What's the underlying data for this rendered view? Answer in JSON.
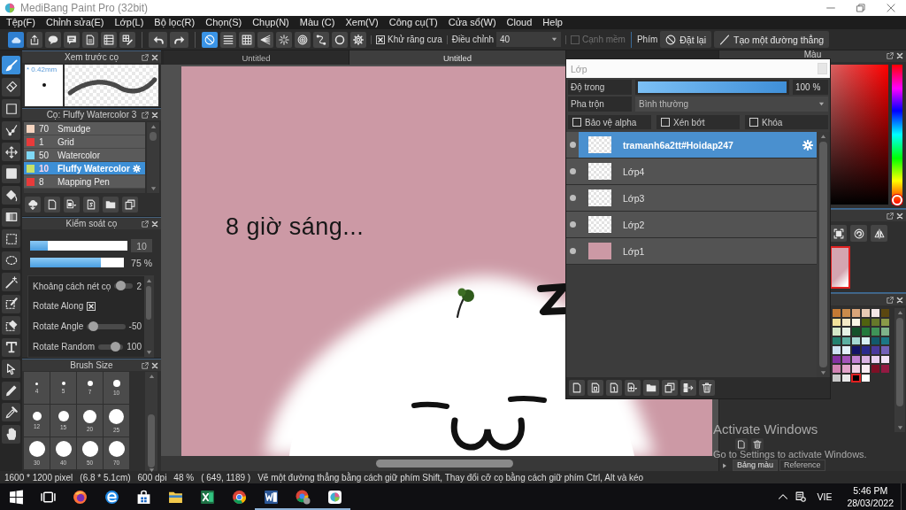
{
  "window": {
    "title": "MediBang Paint Pro (32bit)"
  },
  "menu": [
    "Tệp(F)",
    "Chỉnh sửa(E)",
    "Lớp(L)",
    "Bộ lọc(R)",
    "Chọn(S)",
    "Chụp(N)",
    "Màu (C)",
    "Xem(V)",
    "Công cụ(T)",
    "Cửa sổ(W)",
    "Cloud",
    "Help"
  ],
  "toolbar": {
    "file_tools": [
      {
        "kind": "cloud"
      },
      {
        "kind": "share"
      },
      {
        "kind": "bubble"
      },
      {
        "kind": "comment"
      },
      {
        "kind": "page"
      },
      {
        "kind": "list"
      },
      {
        "kind": "grid-edit"
      }
    ],
    "history": [
      {
        "kind": "undo"
      },
      {
        "kind": "redo"
      }
    ],
    "snaps": [
      {
        "kind": "off",
        "selected": true
      },
      {
        "kind": "parallel",
        "selected": false
      },
      {
        "kind": "grid",
        "selected": false
      },
      {
        "kind": "perspective",
        "selected": false
      },
      {
        "kind": "radial",
        "selected": false
      },
      {
        "kind": "concentric",
        "selected": false
      },
      {
        "kind": "curve",
        "selected": false
      },
      {
        "kind": "circle",
        "selected": false
      },
      {
        "kind": "settings",
        "selected": false
      }
    ],
    "antialias": {
      "label": "Khử răng cưa",
      "checked": true
    },
    "correction": {
      "label": "Điều chỉnh",
      "value": "40"
    },
    "soft_edge": {
      "label": "Cạnh mềm",
      "checked": false,
      "disabled": true
    },
    "shortcut_label": "Phím",
    "actions": [
      {
        "kind": "reset",
        "label": "Đặt lại"
      },
      {
        "kind": "line",
        "label": "Tạo một đường thẳng"
      }
    ]
  },
  "tools": [
    {
      "kind": "brush",
      "selected": true
    },
    {
      "kind": "eraser",
      "selected": false
    },
    {
      "kind": "dot",
      "selected": false
    },
    {
      "kind": "vector",
      "selected": false
    },
    {
      "kind": "move",
      "selected": false
    },
    {
      "kind": "fill-rect",
      "selected": false
    },
    {
      "kind": "bucket",
      "selected": false
    },
    {
      "kind": "gradient",
      "selected": false
    },
    {
      "kind": "select",
      "selected": false
    },
    {
      "kind": "lasso",
      "selected": false
    },
    {
      "kind": "wand",
      "selected": false
    },
    {
      "kind": "select-pen",
      "selected": false
    },
    {
      "kind": "select-eraser",
      "selected": false
    },
    {
      "kind": "text",
      "selected": false
    },
    {
      "kind": "operation",
      "selected": false
    },
    {
      "kind": "divide",
      "selected": false
    },
    {
      "kind": "eyedropper",
      "selected": false
    },
    {
      "kind": "hand",
      "selected": false
    }
  ],
  "brush_preview": {
    "title": "Xem trước cọ",
    "size": "* 0.42mm"
  },
  "brush_list": {
    "title": "Cọ: Fluffy Watercolor 3",
    "items": [
      {
        "size": "70",
        "name": "Smudge",
        "color": "#f5d5c0",
        "selected": false
      },
      {
        "size": "1",
        "name": "Grid",
        "color": "#e83a3a",
        "selected": false
      },
      {
        "size": "50",
        "name": "Watercolor",
        "color": "#7fd8f5",
        "selected": false
      },
      {
        "size": "10",
        "name": "Fluffy Watercolor",
        "color": "#c6e06a",
        "selected": true
      },
      {
        "size": "8",
        "name": "Mapping Pen",
        "color": "#e83a3a",
        "selected": false
      }
    ],
    "actions": [
      {
        "kind": "cloud-download"
      },
      {
        "kind": "new"
      },
      {
        "kind": "new-menu"
      },
      {
        "kind": "script"
      },
      {
        "kind": "folder"
      },
      {
        "kind": "duplicate"
      }
    ]
  },
  "brush_control": {
    "title": "Kiểm soát cọ",
    "size": {
      "level": 0.18,
      "value": "10"
    },
    "opacity": {
      "level": 0.75,
      "value": "75 %"
    },
    "settings": [
      {
        "kind": "slider",
        "label": "Khoảng cách nét cọ",
        "level": 0.2,
        "value": "2"
      },
      {
        "kind": "checkbox",
        "label": "Rotate Along",
        "checked": true
      },
      {
        "kind": "slider",
        "label": "Rotate Angle",
        "level": 0.05,
        "value": "-50"
      },
      {
        "kind": "slider",
        "label": "Rotate Random",
        "level": 0.8,
        "value": "100"
      }
    ]
  },
  "brush_size": {
    "title": "Brush Size",
    "sizes": [
      "4",
      "5",
      "7",
      "10",
      "12",
      "15",
      "20",
      "25",
      "30",
      "40",
      "50",
      "70"
    ]
  },
  "canvas_tabs": [
    {
      "label": "Untitled",
      "selected": false
    },
    {
      "label": "Untitled",
      "selected": true
    }
  ],
  "canvas": {
    "caption": "8 giờ sáng..."
  },
  "layer_panel": {
    "title": "Lớp",
    "opacity": {
      "label": "Độ trong",
      "level": 1,
      "value": "100 %"
    },
    "blend": {
      "label": "Pha trộn",
      "value": "Bình thường"
    },
    "options": [
      {
        "label": "Bảo vệ alpha",
        "checked": false
      },
      {
        "label": "Xén bớt",
        "checked": false
      },
      {
        "label": "Khóa",
        "checked": false
      }
    ],
    "layers": [
      {
        "name": "tramanh6a2tt#Hoidap247",
        "kind": "transparent",
        "visible": true,
        "selected": true
      },
      {
        "name": "Lớp4",
        "kind": "transparent",
        "visible": true,
        "selected": false
      },
      {
        "name": "Lớp3",
        "kind": "transparent",
        "visible": true,
        "selected": false
      },
      {
        "name": "Lớp2",
        "kind": "transparent",
        "visible": true,
        "selected": false
      },
      {
        "name": "Lớp1",
        "kind": "filled",
        "visible": true,
        "selected": false
      }
    ],
    "actions": [
      {
        "kind": "new"
      },
      {
        "kind": "new-halftone"
      },
      {
        "kind": "new-mono"
      },
      {
        "kind": "add-menu"
      },
      {
        "kind": "folder"
      },
      {
        "kind": "duplicate"
      },
      {
        "kind": "merge"
      },
      {
        "kind": "delete"
      }
    ]
  },
  "color_panel": {
    "title": "Màu"
  },
  "navigator": {
    "tools": [
      {
        "kind": "fit"
      },
      {
        "kind": "rotate"
      },
      {
        "kind": "flip"
      }
    ]
  },
  "palette": {
    "swatches": [
      {
        "color": "#c47a34",
        "selected": false
      },
      {
        "color": "#c98b4b",
        "selected": false
      },
      {
        "color": "#d9a57a",
        "selected": false
      },
      {
        "color": "#e8cbb5",
        "selected": false
      },
      {
        "color": "#f3e6e6",
        "selected": false
      },
      {
        "color": "#5b4710",
        "selected": false
      },
      {
        "color": "#f2e29a",
        "selected": false
      },
      {
        "color": "#f3e9c6",
        "selected": false
      },
      {
        "color": "#fbf6e6",
        "selected": false
      },
      {
        "color": "#50620f",
        "selected": false
      },
      {
        "color": "#66782a",
        "selected": false
      },
      {
        "color": "#8a9a48",
        "selected": false
      },
      {
        "color": "#d4e8c8",
        "selected": false
      },
      {
        "color": "#e6f2e6",
        "selected": false
      },
      {
        "color": "#14512a",
        "selected": false
      },
      {
        "color": "#237a3d",
        "selected": false
      },
      {
        "color": "#3f9458",
        "selected": false
      },
      {
        "color": "#7fb38a",
        "selected": false
      },
      {
        "color": "#23816f",
        "selected": false
      },
      {
        "color": "#5cb0a2",
        "selected": false
      },
      {
        "color": "#a6d9d3",
        "selected": false
      },
      {
        "color": "#d6f1f3",
        "selected": false
      },
      {
        "color": "#125a6b",
        "selected": false
      },
      {
        "color": "#1b7786",
        "selected": false
      },
      {
        "color": "#cde2f2",
        "selected": false
      },
      {
        "color": "#e3f1fa",
        "selected": false
      },
      {
        "color": "#141466",
        "selected": false
      },
      {
        "color": "#2a2b8c",
        "selected": false
      },
      {
        "color": "#4a3a9c",
        "selected": false
      },
      {
        "color": "#7361b8",
        "selected": false
      },
      {
        "color": "#8432a2",
        "selected": false
      },
      {
        "color": "#a454ba",
        "selected": false
      },
      {
        "color": "#c384d4",
        "selected": false
      },
      {
        "color": "#d9b3e3",
        "selected": false
      },
      {
        "color": "#ead2f1",
        "selected": false
      },
      {
        "color": "#f3e3f8",
        "selected": false
      },
      {
        "color": "#d182b3",
        "selected": false
      },
      {
        "color": "#e2a3ca",
        "selected": false
      },
      {
        "color": "#f1d2e3",
        "selected": false
      },
      {
        "color": "#f9ecf3",
        "selected": false
      },
      {
        "color": "#7d0f25",
        "selected": false
      },
      {
        "color": "#931a42",
        "selected": false
      },
      {
        "color": "#c8c8c8",
        "selected": false
      },
      {
        "color": "#e9e9e9",
        "selected": false
      },
      {
        "color": "#000000",
        "selected": true
      },
      {
        "color": "#ffffff",
        "selected": false
      }
    ],
    "actions": [
      {
        "kind": "new"
      },
      {
        "kind": "delete"
      }
    ]
  },
  "dock_tabs": [
    {
      "label": "Bảng màu",
      "selected": true
    },
    {
      "label": "Reference",
      "selected": false
    }
  ],
  "status_bar": [
    "1600 * 1200 pixel",
    "(6.8 * 5.1cm)",
    "600 dpi",
    "48 %",
    "( 649, 1189 )",
    "Vẽ một đường thẳng bằng cách giữ phím Shift, Thay đổi cỡ cọ bằng cách giữ phím Ctrl, Alt và kéo"
  ],
  "taskbar": {
    "items": [
      {
        "kind": "windows",
        "running": false
      },
      {
        "kind": "taskview",
        "running": false
      },
      {
        "kind": "firefox",
        "running": false
      },
      {
        "kind": "edge",
        "running": false
      },
      {
        "kind": "store",
        "running": false
      },
      {
        "kind": "explorer",
        "running": false
      },
      {
        "kind": "excel",
        "running": false
      },
      {
        "kind": "chrome",
        "running": false
      },
      {
        "kind": "word",
        "running": true
      },
      {
        "kind": "chrome-profile",
        "running": true
      },
      {
        "kind": "medibang",
        "running": true
      }
    ],
    "language": "VIE",
    "time": "5:46 PM",
    "date": "28/03/2022"
  },
  "activation_notice": {
    "title": "Activate Windows",
    "message": "Go to Settings to activate Windows."
  }
}
